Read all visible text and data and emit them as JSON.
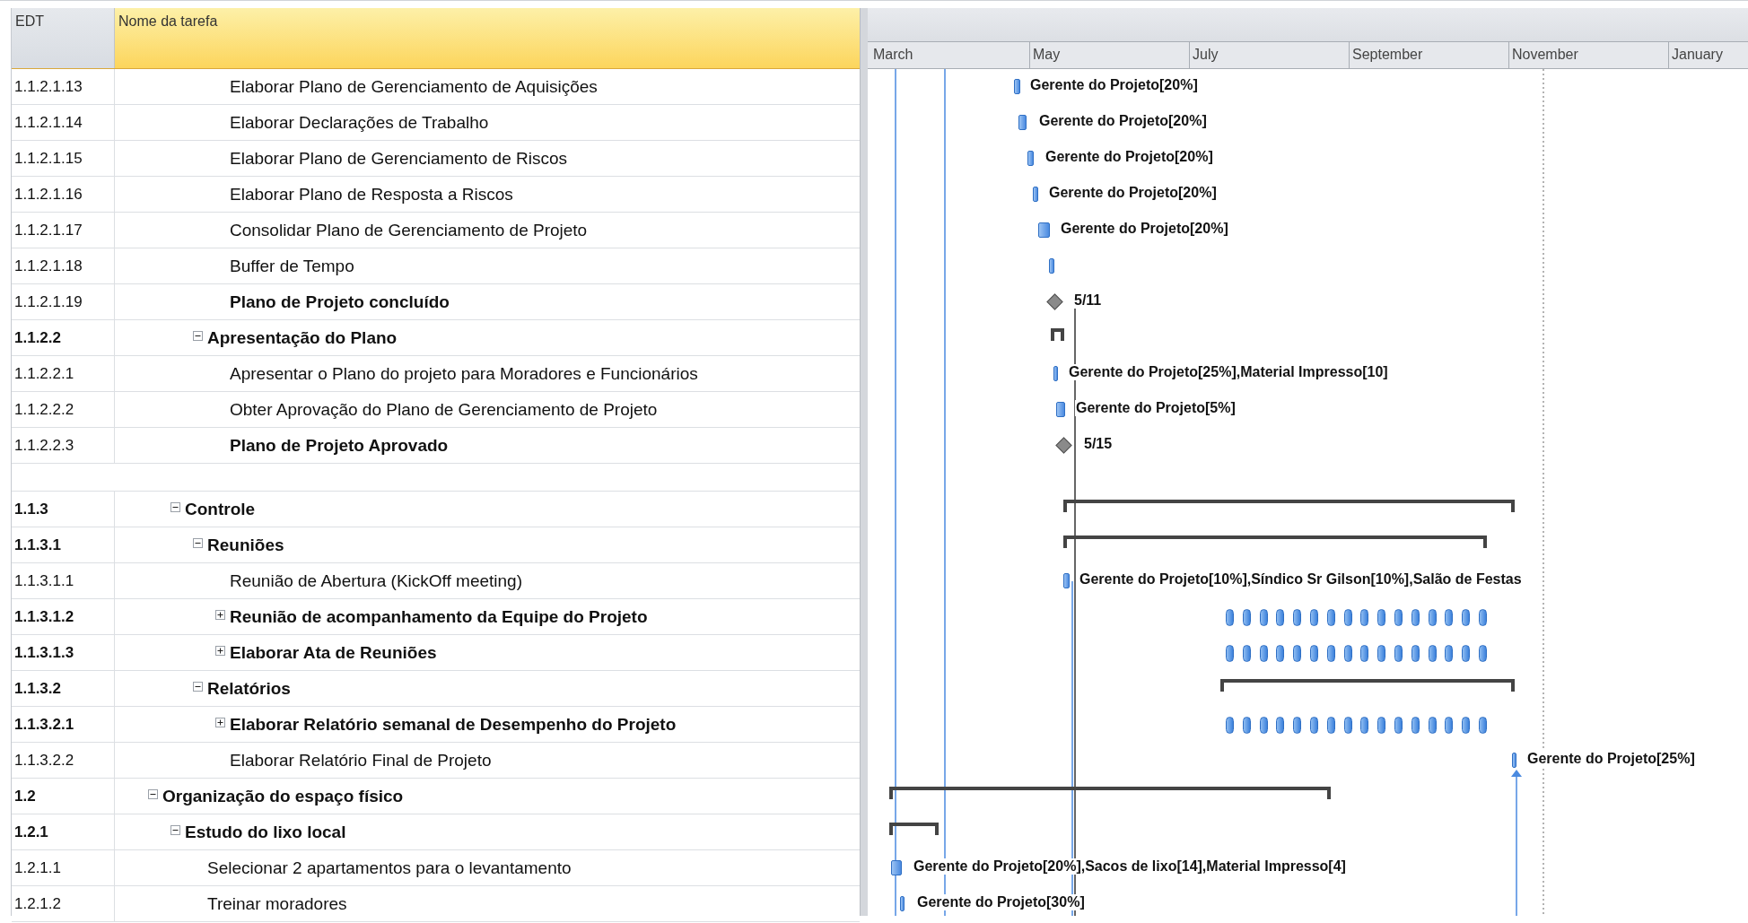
{
  "columns": [
    "EDT",
    "Nome da tarefa"
  ],
  "timescale": [
    "March",
    "May",
    "July",
    "September",
    "November",
    "January"
  ],
  "rows": [
    {
      "edt": "1.1.2.1.13",
      "name": "Elaborar Plano de Gerenciamento de Aquisições",
      "kind": "task",
      "gantt": {
        "kind": "bar",
        "label": "Gerente do Projeto[20%]"
      }
    },
    {
      "edt": "1.1.2.1.14",
      "name": "Elaborar Declarações de Trabalho",
      "kind": "task",
      "gantt": {
        "kind": "bar",
        "label": "Gerente do Projeto[20%]"
      }
    },
    {
      "edt": "1.1.2.1.15",
      "name": "Elaborar Plano de Gerenciamento de Riscos",
      "kind": "task",
      "gantt": {
        "kind": "bar",
        "label": "Gerente do Projeto[20%]"
      }
    },
    {
      "edt": "1.1.2.1.16",
      "name": "Elaborar Plano de Resposta a Riscos",
      "kind": "task",
      "gantt": {
        "kind": "bar",
        "label": "Gerente do Projeto[20%]"
      }
    },
    {
      "edt": "1.1.2.1.17",
      "name": "Consolidar Plano de Gerenciamento de Projeto",
      "kind": "task",
      "gantt": {
        "kind": "bar",
        "label": "Gerente do Projeto[20%]"
      }
    },
    {
      "edt": "1.1.2.1.18",
      "name": "Buffer de Tempo",
      "kind": "task",
      "gantt": {
        "kind": "bar"
      }
    },
    {
      "edt": "1.1.2.1.19",
      "name": "Plano de Projeto concluído",
      "kind": "milestone",
      "gantt": {
        "kind": "milestone",
        "label": "5/11"
      }
    },
    {
      "edt": "1.1.2.2",
      "name": "Apresentação do Plano",
      "kind": "summary",
      "expanded": true,
      "gantt": {
        "kind": "summary"
      },
      "children": [
        {
          "edt": "1.1.2.2.1",
          "name": "Apresentar o Plano do projeto para Moradores e Funcionários",
          "kind": "task",
          "gantt": {
            "kind": "bar",
            "label": "Gerente do Projeto[25%],Material Impresso[10]"
          }
        },
        {
          "edt": "1.1.2.2.2",
          "name": "Obter Aprovação do Plano de Gerenciamento de Projeto",
          "kind": "task",
          "gantt": {
            "kind": "bar",
            "label": "Gerente do Projeto[5%]"
          }
        },
        {
          "edt": "1.1.2.2.3",
          "name": "Plano de Projeto Aprovado",
          "kind": "milestone",
          "gantt": {
            "kind": "milestone",
            "label": "5/15"
          }
        }
      ]
    },
    {
      "kind": "blank"
    },
    {
      "edt": "1.1.3",
      "name": "Controle",
      "kind": "summary",
      "expanded": true,
      "gantt": {
        "kind": "summary"
      },
      "children": [
        {
          "edt": "1.1.3.1",
          "name": "Reuniões",
          "kind": "summary",
          "expanded": true,
          "gantt": {
            "kind": "summary"
          },
          "children": [
            {
              "edt": "1.1.3.1.1",
              "name": "Reunião de Abertura (KickOff meeting)",
              "kind": "task",
              "gantt": {
                "kind": "bar",
                "label": "Gerente do Projeto[10%],Síndico Sr Gilson[10%],Salão de Festas"
              }
            },
            {
              "edt": "1.1.3.1.2",
              "name": "Reunião de acompanhamento da Equipe do Projeto",
              "kind": "summary",
              "expanded": false,
              "gantt": {
                "kind": "recurring"
              }
            },
            {
              "edt": "1.1.3.1.3",
              "name": "Elaborar Ata de Reuniões",
              "kind": "summary",
              "expanded": false,
              "gantt": {
                "kind": "recurring"
              }
            }
          ]
        },
        {
          "edt": "1.1.3.2",
          "name": "Relatórios",
          "kind": "summary",
          "expanded": true,
          "gantt": {
            "kind": "summary"
          },
          "children": [
            {
              "edt": "1.1.3.2.1",
              "name": "Elaborar Relatório semanal de Desempenho do Projeto",
              "kind": "summary",
              "expanded": false,
              "gantt": {
                "kind": "recurring"
              }
            },
            {
              "edt": "1.1.3.2.2",
              "name": "Elaborar Relatório Final de Projeto",
              "kind": "task",
              "gantt": {
                "kind": "bar",
                "label": "Gerente do Projeto[25%]"
              }
            }
          ]
        }
      ]
    },
    {
      "edt": "1.2",
      "name": "Organização do espaço físico",
      "kind": "summary",
      "expanded": true,
      "gantt": {
        "kind": "summary"
      },
      "children": [
        {
          "edt": "1.2.1",
          "name": "Estudo do lixo local",
          "kind": "summary",
          "expanded": true,
          "gantt": {
            "kind": "summary"
          },
          "children": [
            {
              "edt": "1.2.1.1",
              "name": "Selecionar 2 apartamentos para o levantamento",
              "kind": "task",
              "gantt": {
                "kind": "bar",
                "label": "Gerente do Projeto[20%],Sacos de lixo[14],Material Impresso[4]"
              }
            },
            {
              "edt": "1.2.1.2",
              "name": "Treinar moradores",
              "kind": "task",
              "gantt": {
                "kind": "bar",
                "label": "Gerente do Projeto[30%]"
              }
            }
          ]
        }
      ]
    }
  ]
}
